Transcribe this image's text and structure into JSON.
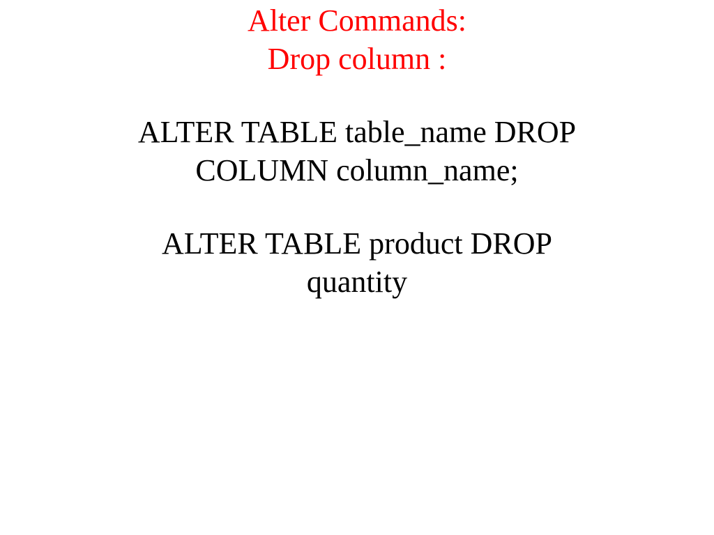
{
  "heading": {
    "line1": "Alter Commands:",
    "line2": "Drop column :"
  },
  "syntax": {
    "line1": "ALTER TABLE table_name DROP",
    "line2": "COLUMN column_name;"
  },
  "example": {
    "line1": "ALTER TABLE product DROP",
    "line2": "quantity"
  }
}
